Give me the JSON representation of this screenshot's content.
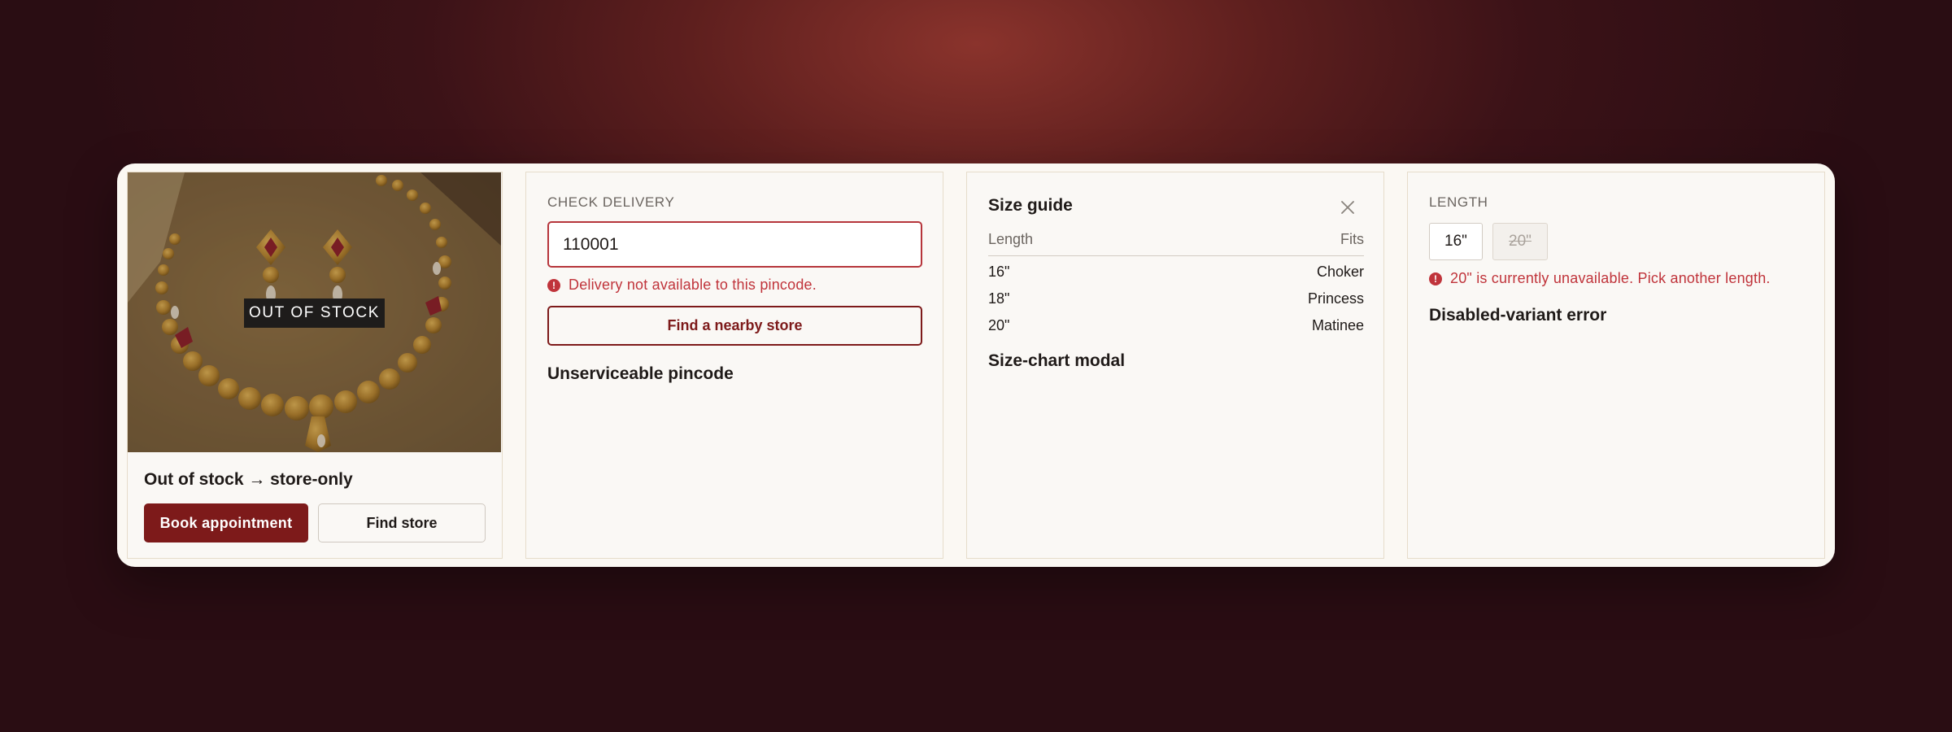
{
  "card_oos": {
    "badge": "OUT OF STOCK",
    "title": "Out of stock → store-only",
    "primary_button": "Book appointment",
    "secondary_button": "Find store",
    "colors": {
      "primary": "#7d1a1a",
      "badge_bg": "#1e1c1b"
    }
  },
  "card_delivery": {
    "label": "CHECK DELIVERY",
    "pincode_value": "110001",
    "error_text": "Delivery not available to this pincode.",
    "button": "Find a nearby store",
    "caption": "Unserviceable pincode",
    "colors": {
      "error": "#c0343b",
      "accent": "#7d1a1a"
    }
  },
  "card_size_guide": {
    "title": "Size guide",
    "columns": [
      "Length",
      "Fits"
    ],
    "rows": [
      {
        "length": "16\"",
        "fits": "Choker"
      },
      {
        "length": "18\"",
        "fits": "Princess"
      },
      {
        "length": "20\"",
        "fits": "Matinee"
      }
    ],
    "caption": "Size-chart modal"
  },
  "card_variant": {
    "label": "LENGTH",
    "options": [
      {
        "label": "16\"",
        "state": "available"
      },
      {
        "label": "20\"",
        "state": "disabled"
      }
    ],
    "error_text": "20\" is currently unavailable. Pick another length.",
    "caption": "Disabled-variant error"
  }
}
